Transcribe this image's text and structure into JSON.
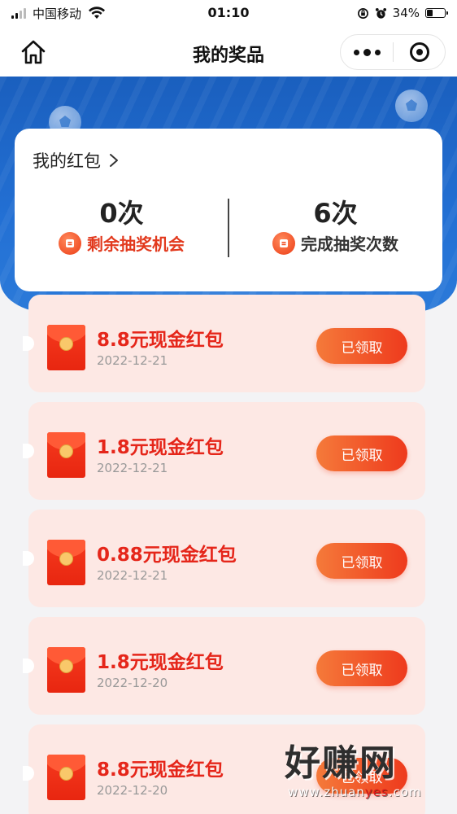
{
  "status_bar": {
    "carrier": "中国移动",
    "time": "01:10",
    "battery": "34%",
    "battery_level": 0.34
  },
  "nav": {
    "title": "我的奖品",
    "icons": [
      "home-icon",
      "more-icon",
      "close-mini-program-icon"
    ]
  },
  "stats": {
    "header": "我的红包",
    "remaining_count": "0次",
    "remaining_label": "剩余抽奖机会",
    "completed_count": "6次",
    "completed_label": "完成抽奖次数"
  },
  "prizes": [
    {
      "title": "8.8元现金红包",
      "date": "2022-12-21",
      "button": "已领取"
    },
    {
      "title": "1.8元现金红包",
      "date": "2022-12-21",
      "button": "已领取"
    },
    {
      "title": "0.88元现金红包",
      "date": "2022-12-21",
      "button": "已领取"
    },
    {
      "title": "1.8元现金红包",
      "date": "2022-12-20",
      "button": "已领取"
    },
    {
      "title": "8.8元现金红包",
      "date": "2022-12-20",
      "button": "已领取"
    }
  ],
  "watermark": {
    "text": "好赚网",
    "url_prefix": "www.zhuan",
    "url_accent": "yes",
    "url_suffix": ".com"
  },
  "colors": {
    "banner_blue": "#1a5fbe",
    "prize_red": "#e5261a",
    "card_pink": "#fde8e4",
    "button_gradient_start": "#f57a3a",
    "button_gradient_end": "#ee3a1d"
  }
}
